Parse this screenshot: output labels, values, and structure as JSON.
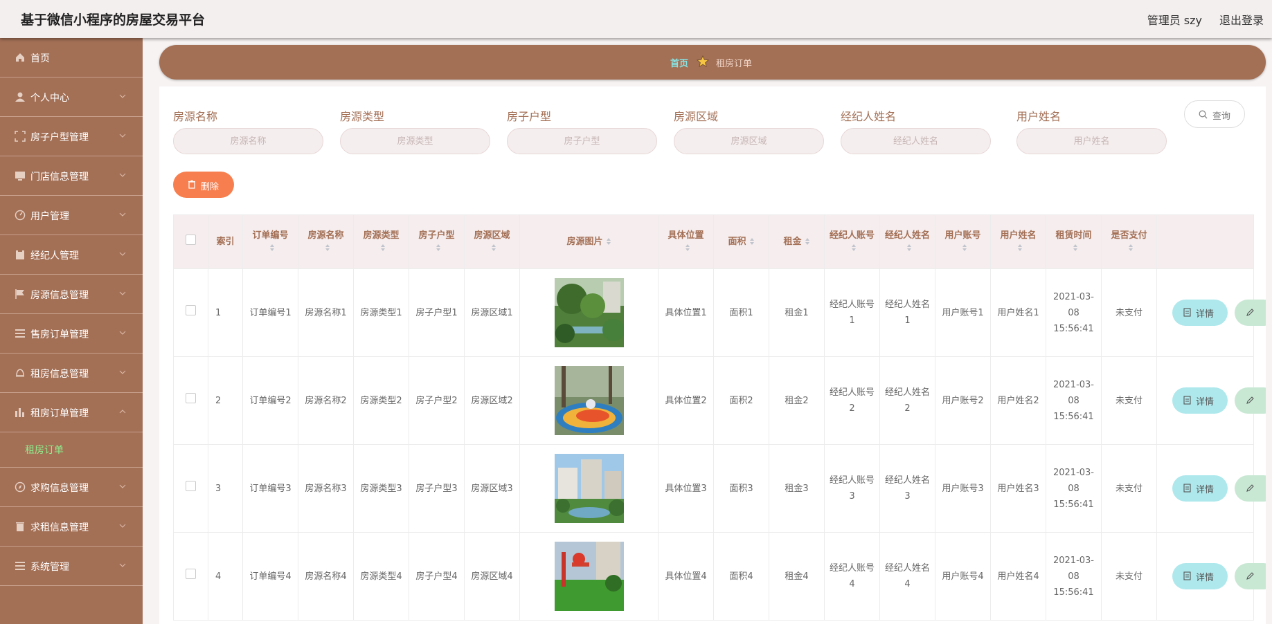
{
  "header": {
    "title": "基于微信小程序的房屋交易平台",
    "user": "管理员 szy",
    "logout": "退出登录"
  },
  "sidebar": {
    "items": [
      {
        "label": "首页",
        "icon": "home-icon"
      },
      {
        "label": "个人中心",
        "icon": "user-icon"
      },
      {
        "label": "房子户型管理",
        "icon": "frame-icon"
      },
      {
        "label": "门店信息管理",
        "icon": "monitor-icon"
      },
      {
        "label": "用户管理",
        "icon": "gauge-icon"
      },
      {
        "label": "经纪人管理",
        "icon": "clipboard-icon"
      },
      {
        "label": "房源信息管理",
        "icon": "flag-icon"
      },
      {
        "label": "售房订单管理",
        "icon": "list-icon"
      },
      {
        "label": "租房信息管理",
        "icon": "bell-icon"
      },
      {
        "label": "租房订单管理",
        "icon": "chart-icon"
      },
      {
        "label": "求购信息管理",
        "icon": "compass-icon"
      },
      {
        "label": "求租信息管理",
        "icon": "trash-icon"
      },
      {
        "label": "系统管理",
        "icon": "menu-icon"
      }
    ],
    "submenu": "租房订单"
  },
  "breadcrumb": {
    "home": "首页",
    "current": "租房订单"
  },
  "filters": [
    {
      "label": "房源名称",
      "placeholder": "房源名称"
    },
    {
      "label": "房源类型",
      "placeholder": "房源类型"
    },
    {
      "label": "房子户型",
      "placeholder": "房子户型"
    },
    {
      "label": "房源区域",
      "placeholder": "房源区域"
    },
    {
      "label": "经纪人姓名",
      "placeholder": "经纪人姓名"
    },
    {
      "label": "用户姓名",
      "placeholder": "用户姓名"
    }
  ],
  "buttons": {
    "search": "查询",
    "delete": "删除",
    "detail": "详情"
  },
  "table": {
    "headers": [
      "索引",
      "订单编号",
      "房源名称",
      "房源类型",
      "房子户型",
      "房源区域",
      "房源图片",
      "具体位置",
      "面积",
      "租金",
      "经纪人账号",
      "经纪人姓名",
      "用户账号",
      "用户姓名",
      "租赁时间",
      "是否支付"
    ],
    "rows": [
      [
        "1",
        "订单编号1",
        "房源名称1",
        "房源类型1",
        "房子户型1",
        "房源区域1",
        "具体位置1",
        "面积1",
        "租金1",
        "经纪人账号1",
        "经纪人姓名1",
        "用户账号1",
        "用户姓名1",
        "2021-03-08 15:56:41",
        "未支付"
      ],
      [
        "2",
        "订单编号2",
        "房源名称2",
        "房源类型2",
        "房子户型2",
        "房源区域2",
        "具体位置2",
        "面积2",
        "租金2",
        "经纪人账号2",
        "经纪人姓名2",
        "用户账号2",
        "用户姓名2",
        "2021-03-08 15:56:41",
        "未支付"
      ],
      [
        "3",
        "订单编号3",
        "房源名称3",
        "房源类型3",
        "房子户型3",
        "房源区域3",
        "具体位置3",
        "面积3",
        "租金3",
        "经纪人账号3",
        "经纪人姓名3",
        "用户账号3",
        "用户姓名3",
        "2021-03-08 15:56:41",
        "未支付"
      ],
      [
        "4",
        "订单编号4",
        "房源名称4",
        "房源类型4",
        "房子户型4",
        "房源区域4",
        "具体位置4",
        "面积4",
        "租金4",
        "经纪人账号4",
        "经纪人姓名4",
        "用户账号4",
        "用户姓名4",
        "2021-03-08 15:56:41",
        "未支付"
      ]
    ]
  },
  "colors": {
    "brand": "#a36f55",
    "accent": "#f77f4f",
    "active_menu": "#8ef08e",
    "detail": "#aee8ec"
  }
}
